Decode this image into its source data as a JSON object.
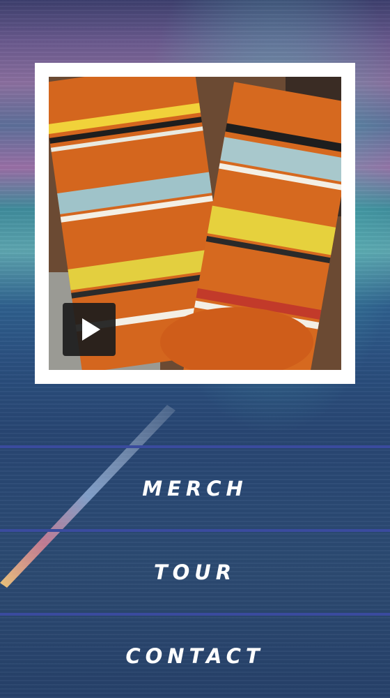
{
  "video": {
    "thumbnail_description": "video-thumbnail",
    "play_icon": "play-icon"
  },
  "nav": {
    "items": [
      {
        "label": "MERCH"
      },
      {
        "label": "TOUR"
      },
      {
        "label": "CONTACT"
      }
    ]
  },
  "colors": {
    "divider": "#3a4b9e",
    "card_border": "#ffffff",
    "nav_text": "#ffffff"
  }
}
